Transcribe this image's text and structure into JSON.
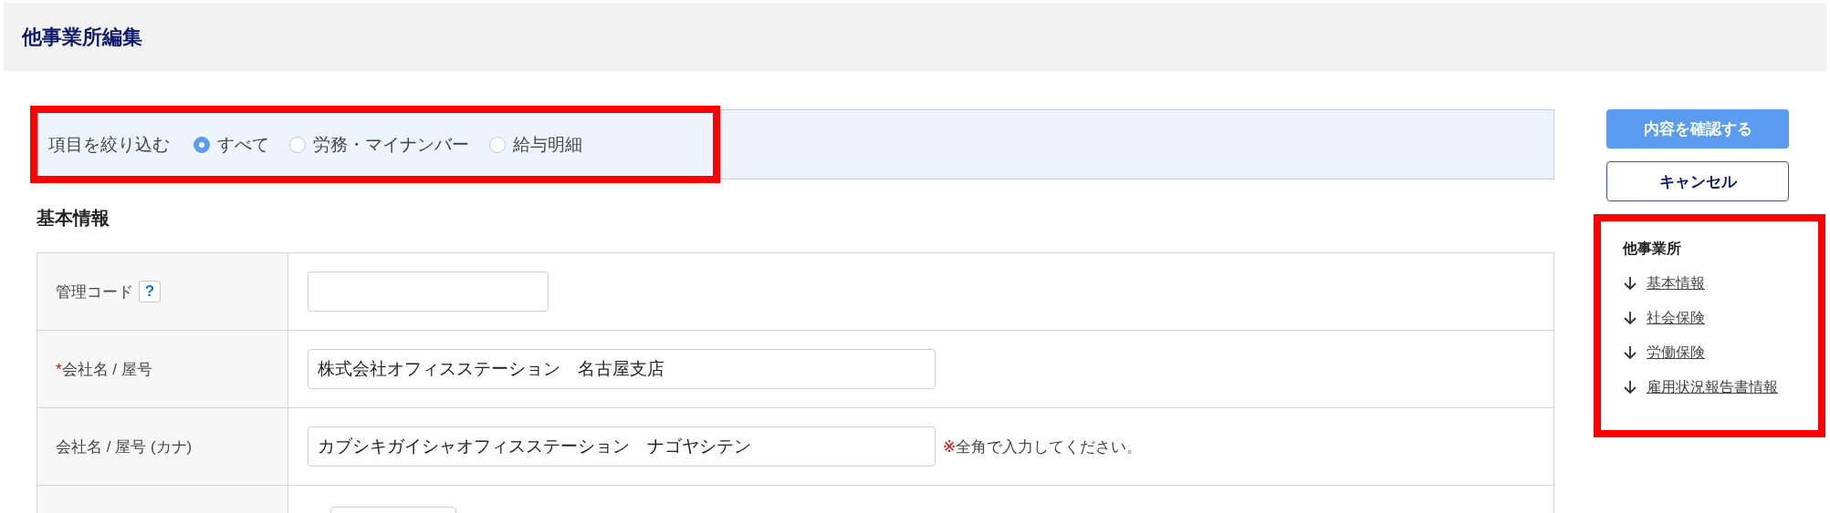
{
  "page": {
    "title": "他事業所編集"
  },
  "filter": {
    "label": "項目を絞り込む",
    "highlighted": true,
    "options": [
      {
        "label": "すべて",
        "selected": true
      },
      {
        "label": "労務・マイナンバー",
        "selected": false
      },
      {
        "label": "給与明細",
        "selected": false
      }
    ]
  },
  "section": {
    "title": "基本情報"
  },
  "rows": [
    {
      "kind": "short",
      "label": "管理コード",
      "help": "?"
    },
    {
      "kind": "long",
      "label": "会社名 / 屋号",
      "mark": "*",
      "value": "株式会社オフィスステーション　名古屋支店"
    },
    {
      "kind": "long",
      "label": "会社名 / 屋号 (カナ)",
      "value": "カブシキガイシャオフィスステーション　ナゴヤシテン",
      "note_mark": "※",
      "note": "全角で入力してください。"
    },
    {
      "kind": "partial"
    }
  ],
  "actions": [
    {
      "kind": "primary",
      "label": "内容を確認する"
    },
    {
      "kind": "secondary",
      "label": "キャンセル"
    }
  ],
  "nav": {
    "title": "他事業所",
    "highlighted": true,
    "links": [
      "基本情報",
      "社会保険",
      "労働保険",
      "雇用状況報告書情報"
    ]
  }
}
